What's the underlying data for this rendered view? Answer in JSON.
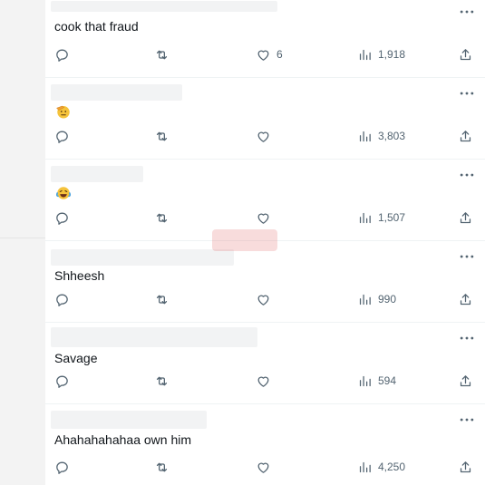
{
  "replies": [
    {
      "text": "cook that fraud",
      "emoji": "",
      "likes": "6",
      "views": "1,918"
    },
    {
      "text": "",
      "emoji": "saluting-face-emoji",
      "likes": "",
      "views": "3,803"
    },
    {
      "text": "",
      "emoji": "crying-laughing-emoji",
      "likes": "",
      "views": "1,507"
    },
    {
      "text": "Shheesh",
      "emoji": "",
      "likes": "",
      "views": "990"
    },
    {
      "text": "Savage",
      "emoji": "",
      "likes": "",
      "views": "594"
    },
    {
      "text": "Ahahahahahaa own him",
      "emoji": "",
      "likes": "",
      "views": "4,250"
    }
  ],
  "icons": {
    "more": "more-horizontal-icon",
    "reply": "reply-bubble-icon",
    "retweet": "retweet-icon",
    "like": "heart-icon",
    "views": "views-bar-chart-icon",
    "share": "share-upload-icon"
  },
  "colors": {
    "icon": "#536471",
    "text": "#0f1419",
    "divider": "#eff3f4"
  }
}
